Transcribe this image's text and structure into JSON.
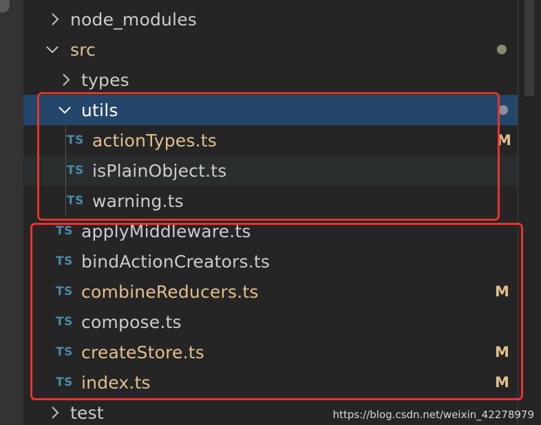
{
  "explorer": {
    "folders": {
      "node_modules": "node_modules",
      "src": "src",
      "types": "types",
      "utils": "utils",
      "test": "test"
    },
    "utils_files": [
      {
        "name": "actionTypes.ts",
        "icon": "TS",
        "status": "M"
      },
      {
        "name": "isPlainObject.ts",
        "icon": "TS",
        "status": ""
      },
      {
        "name": "warning.ts",
        "icon": "TS",
        "status": ""
      }
    ],
    "src_files": [
      {
        "name": "applyMiddleware.ts",
        "icon": "TS",
        "status": ""
      },
      {
        "name": "bindActionCreators.ts",
        "icon": "TS",
        "status": ""
      },
      {
        "name": "combineReducers.ts",
        "icon": "TS",
        "status": "M"
      },
      {
        "name": "compose.ts",
        "icon": "TS",
        "status": ""
      },
      {
        "name": "createStore.ts",
        "icon": "TS",
        "status": "M"
      },
      {
        "name": "index.ts",
        "icon": "TS",
        "status": "M"
      }
    ]
  },
  "watermark": "https://blog.csdn.net/weixin_42278979",
  "colors": {
    "background": "#252526",
    "selection": "#24466b",
    "modified": "#e2c08d",
    "ts_icon": "#498ba7",
    "highlight_box": "#e8352b"
  }
}
